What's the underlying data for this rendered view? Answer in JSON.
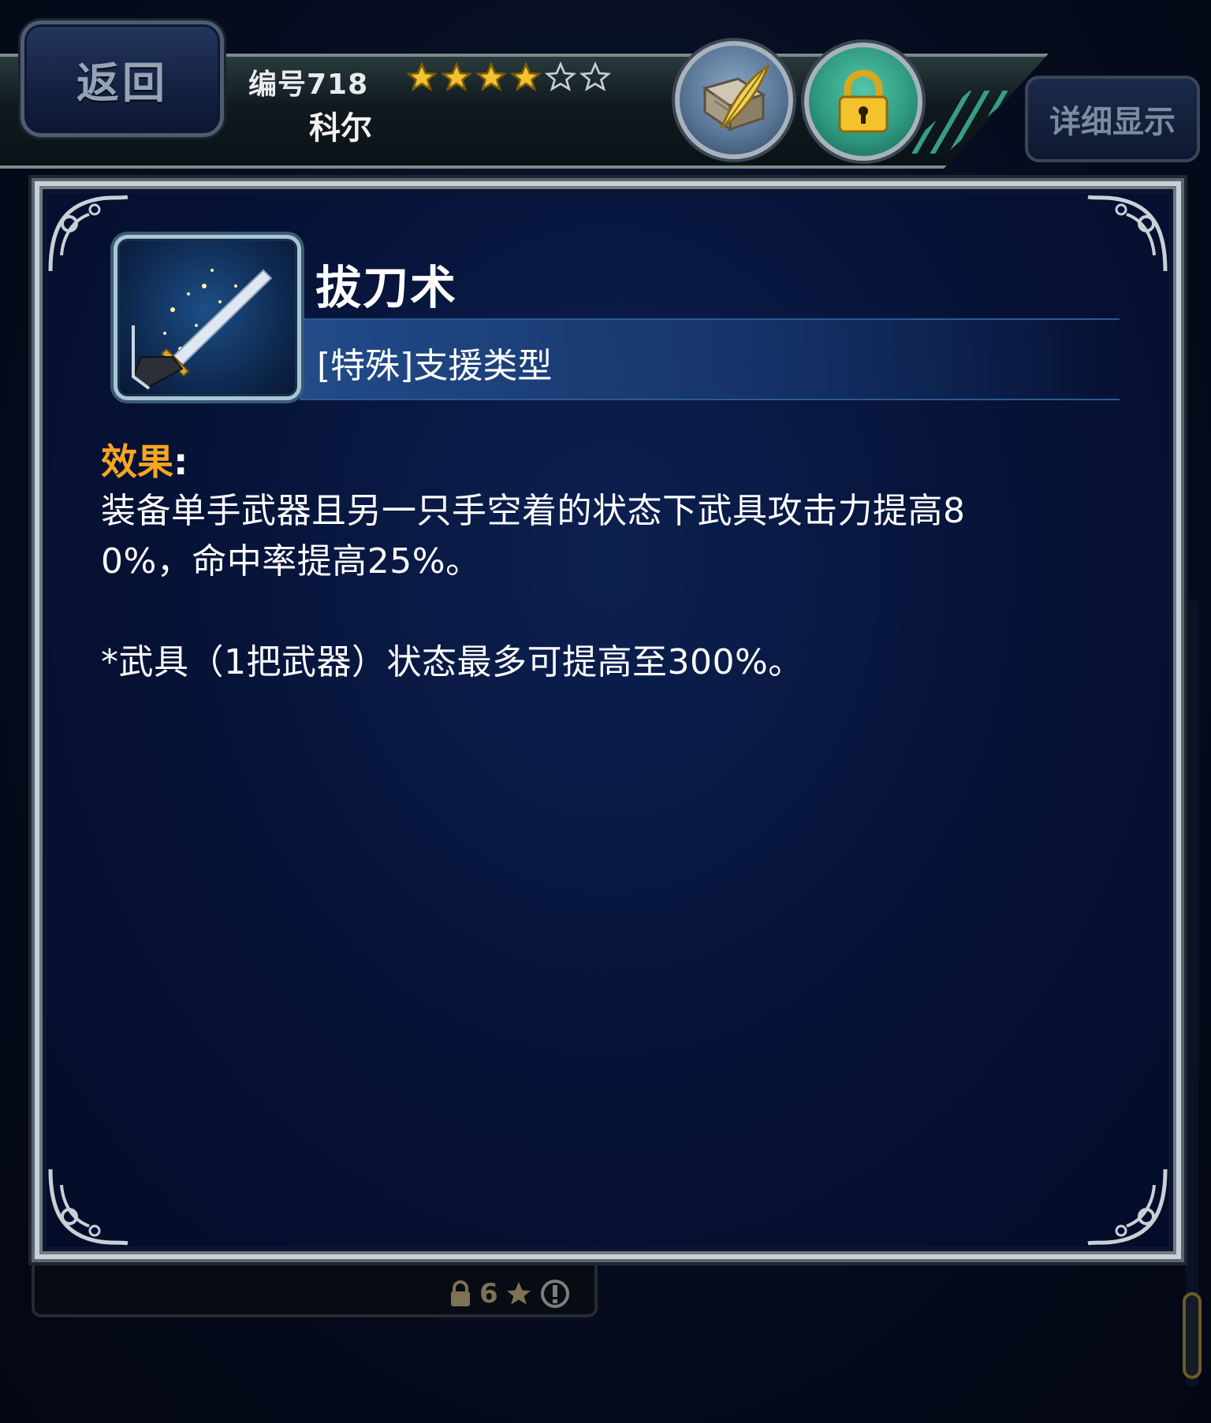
{
  "header": {
    "back_label": "返回",
    "unit_number": "编号718",
    "rarity": {
      "filled": 4,
      "total": 6
    },
    "unit_name": "科尔",
    "detail_label": "详细显示"
  },
  "ability": {
    "name": "拔刀术",
    "type": "[特殊]支援类型",
    "effect_label": "效果",
    "effect_colon": ":",
    "desc_line1": "装备单手武器且另一只手空着的状态下武具攻击力提高8",
    "desc_line2": "0%，命中率提高25%。",
    "desc_line3": "*武具（1把武器）状态最多可提高至300%。"
  },
  "background_list": {
    "unlock_level": "6"
  },
  "colors": {
    "accent_orange": "#f6a623",
    "panel_blue": "#061236",
    "lock_teal": "#2f9a80"
  }
}
